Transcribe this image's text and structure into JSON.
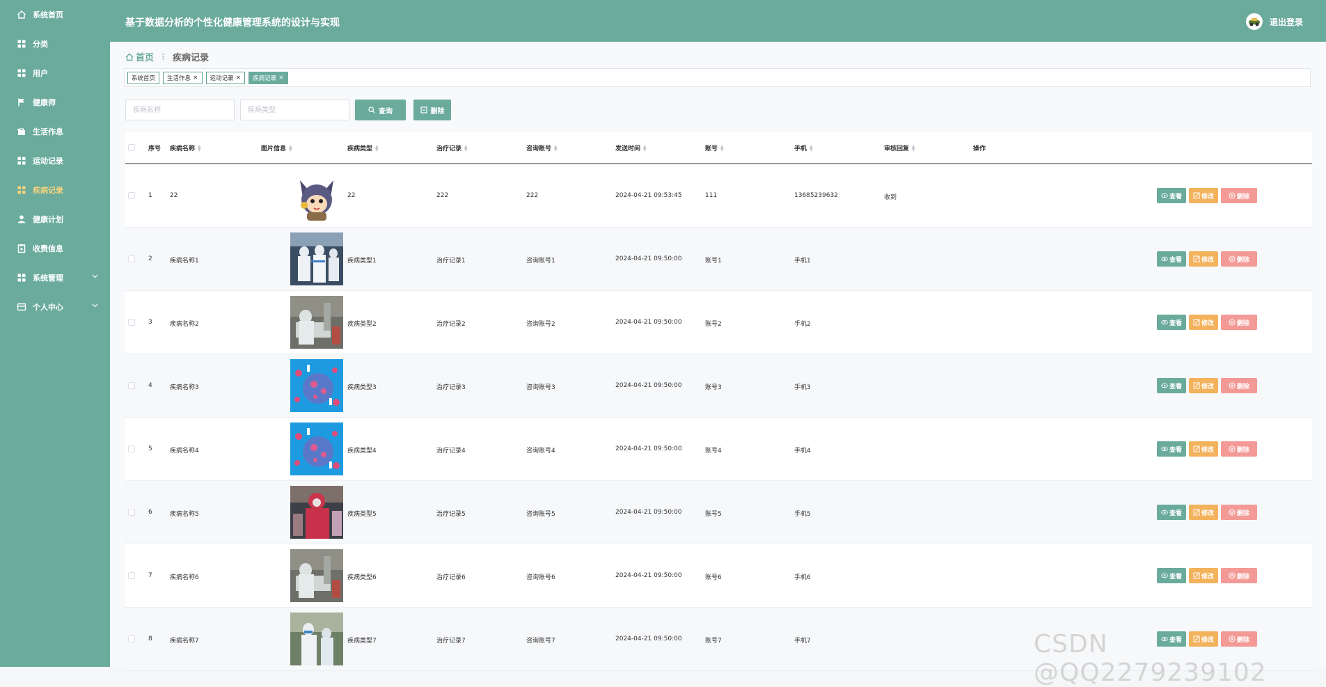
{
  "sidebar": {
    "items": [
      {
        "label": "系统首页",
        "icon": "home-icon"
      },
      {
        "label": "分类",
        "icon": "grid-icon"
      },
      {
        "label": "用户",
        "icon": "grid-icon"
      },
      {
        "label": "健康师",
        "icon": "flag-icon"
      },
      {
        "label": "生活作息",
        "icon": "bag-icon"
      },
      {
        "label": "运动记录",
        "icon": "grid-icon"
      },
      {
        "label": "疾病记录",
        "icon": "grid-icon",
        "active": true
      },
      {
        "label": "健康计划",
        "icon": "person-icon"
      },
      {
        "label": "收费信息",
        "icon": "clipboard-icon"
      },
      {
        "label": "系统管理",
        "icon": "grid-icon"
      },
      {
        "label": "个人中心",
        "icon": "card-icon"
      }
    ]
  },
  "header": {
    "title": "基于数据分析的个性化健康管理系统的设计与实现",
    "logout": "退出登录"
  },
  "breadcrumb": {
    "home": "首页",
    "sep": "⋮",
    "current": "疾病记录"
  },
  "tags": [
    {
      "label": "系统首页",
      "closable": false
    },
    {
      "label": "生活作息",
      "closable": true
    },
    {
      "label": "运动记录",
      "closable": true
    },
    {
      "label": "疾病记录",
      "closable": true,
      "active": true
    }
  ],
  "search": {
    "name_placeholder": "疾病名称",
    "type_placeholder": "疾病类型",
    "query_label": "查询",
    "delete_label": "删除"
  },
  "table": {
    "headers": [
      "序号",
      "疾病名称",
      "图片信息",
      "疾病类型",
      "治疗记录",
      "咨询账号",
      "发送时间",
      "账号",
      "手机",
      "审核回复",
      "操作"
    ],
    "rows": [
      {
        "idx": "1",
        "name": "22",
        "image": "cartoon",
        "type": "22",
        "treat": "222",
        "consult": "222",
        "time": "2024-04-21 09:53:45",
        "account": "111",
        "phone": "13685239632",
        "reply": "收到"
      },
      {
        "idx": "2",
        "name": "疾病名称1",
        "image": "ppe",
        "type": "疾病类型1",
        "treat": "治疗记录1",
        "consult": "咨询账号1",
        "time": "2024-04-21 09:50:00",
        "account": "账号1",
        "phone": "手机1",
        "reply": ""
      },
      {
        "idx": "3",
        "name": "疾病名称2",
        "image": "ward",
        "type": "疾病类型2",
        "treat": "治疗记录2",
        "consult": "咨询账号2",
        "time": "2024-04-21 09:50:00",
        "account": "账号2",
        "phone": "手机2",
        "reply": ""
      },
      {
        "idx": "4",
        "name": "疾病名称3",
        "image": "virus",
        "type": "疾病类型3",
        "treat": "治疗记录3",
        "consult": "咨询账号3",
        "time": "2024-04-21 09:50:00",
        "account": "账号3",
        "phone": "手机3",
        "reply": ""
      },
      {
        "idx": "5",
        "name": "疾病名称4",
        "image": "virus",
        "type": "疾病类型4",
        "treat": "治疗记录4",
        "consult": "咨询账号4",
        "time": "2024-04-21 09:50:00",
        "account": "账号4",
        "phone": "手机4",
        "reply": ""
      },
      {
        "idx": "6",
        "name": "疾病名称5",
        "image": "red",
        "type": "疾病类型5",
        "treat": "治疗记录5",
        "consult": "咨询账号5",
        "time": "2024-04-21 09:50:00",
        "account": "账号5",
        "phone": "手机5",
        "reply": ""
      },
      {
        "idx": "7",
        "name": "疾病名称6",
        "image": "ward",
        "type": "疾病类型6",
        "treat": "治疗记录6",
        "consult": "咨询账号6",
        "time": "2024-04-21 09:50:00",
        "account": "账号6",
        "phone": "手机6",
        "reply": ""
      },
      {
        "idx": "8",
        "name": "疾病名称7",
        "image": "ppe2",
        "type": "疾病类型7",
        "treat": "治疗记录7",
        "consult": "咨询账号7",
        "time": "2024-04-21 09:50:00",
        "account": "账号7",
        "phone": "手机7",
        "reply": ""
      }
    ],
    "actions": {
      "view": "查看",
      "edit": "修改",
      "delete": "删除"
    }
  },
  "watermark": "CSDN @QQ2279239102",
  "colors": {
    "primary": "#6aab9c",
    "edit": "#f3b25c",
    "delete": "#f39a96",
    "active_menu": "#f5d37c"
  }
}
